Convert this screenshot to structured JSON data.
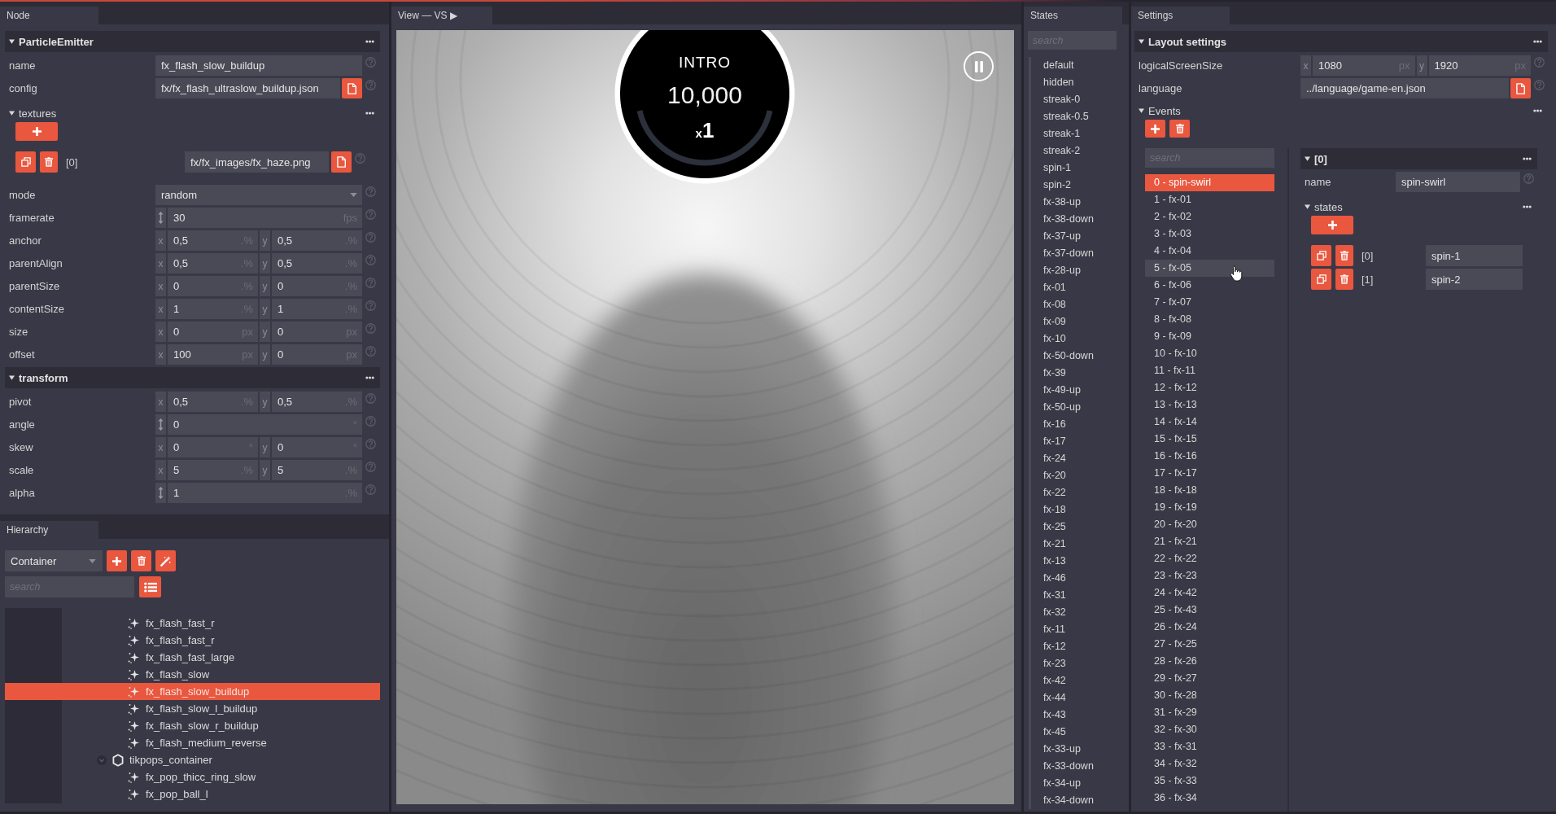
{
  "node": {
    "tab": "Node",
    "sections": [
      {
        "title": "ParticleEmitter",
        "expanded": true,
        "rows": [
          {
            "kind": "text",
            "label": "name",
            "value": "fx_flash_slow_buildup"
          },
          {
            "kind": "file",
            "label": "config",
            "value": "fx/fx_flash_ultraslow_buildup.json"
          },
          {
            "kind": "list",
            "label": "textures",
            "expanded": true,
            "items": [
              {
                "kind": "file",
                "index": "[0]",
                "value": "fx/fx_images/fx_haze.png"
              }
            ]
          },
          {
            "kind": "select",
            "label": "mode",
            "value": "random"
          },
          {
            "kind": "number",
            "label": "framerate",
            "value": "30",
            "unit": "fps"
          },
          {
            "kind": "vector",
            "label": "anchor",
            "parts": [
              {
                "axis": "x",
                "value": "0,5",
                "unit": ".%"
              },
              {
                "axis": "y",
                "value": "0,5",
                "unit": ".%"
              }
            ]
          },
          {
            "kind": "vector",
            "label": "parentAlign",
            "parts": [
              {
                "axis": "x",
                "value": "0,5",
                "unit": ".%"
              },
              {
                "axis": "y",
                "value": "0,5",
                "unit": ".%"
              }
            ]
          },
          {
            "kind": "vector",
            "label": "parentSize",
            "parts": [
              {
                "axis": "x",
                "value": "0",
                "unit": ".%"
              },
              {
                "axis": "y",
                "value": "0",
                "unit": ".%"
              }
            ]
          },
          {
            "kind": "vector",
            "label": "contentSize",
            "parts": [
              {
                "axis": "x",
                "value": "1",
                "unit": ".%"
              },
              {
                "axis": "y",
                "value": "1",
                "unit": ".%"
              }
            ]
          },
          {
            "kind": "vector",
            "label": "size",
            "parts": [
              {
                "axis": "x",
                "value": "0",
                "unit": "px"
              },
              {
                "axis": "y",
                "value": "0",
                "unit": "px"
              }
            ]
          },
          {
            "kind": "vector",
            "label": "offset",
            "parts": [
              {
                "axis": "x",
                "value": "100",
                "unit": "px"
              },
              {
                "axis": "y",
                "value": "0",
                "unit": "px"
              }
            ]
          }
        ]
      },
      {
        "title": "transform",
        "expanded": true,
        "rows": [
          {
            "kind": "vector",
            "label": "pivot",
            "parts": [
              {
                "axis": "x",
                "value": "0,5",
                "unit": ".%"
              },
              {
                "axis": "y",
                "value": "0,5",
                "unit": ".%"
              }
            ]
          },
          {
            "kind": "number",
            "label": "angle",
            "value": "0",
            "unit": "°"
          },
          {
            "kind": "vector",
            "label": "skew",
            "parts": [
              {
                "axis": "x",
                "value": "0",
                "unit": "°"
              },
              {
                "axis": "y",
                "value": "0",
                "unit": "°"
              }
            ]
          },
          {
            "kind": "vector",
            "label": "scale",
            "parts": [
              {
                "axis": "x",
                "value": "5",
                "unit": ".%"
              },
              {
                "axis": "y",
                "value": "5",
                "unit": ".%"
              }
            ]
          },
          {
            "kind": "number",
            "label": "alpha",
            "value": "1",
            "unit": ".%"
          }
        ]
      }
    ]
  },
  "hierarchy": {
    "tab": "Hierarchy",
    "type_select": "Container",
    "search_placeholder": "search",
    "tree": [
      {
        "children": [
          {
            "kind": "emitter",
            "label": "fx_flash_fast_r",
            "selected": false
          },
          {
            "kind": "emitter",
            "label": "fx_flash_fast_r",
            "selected": false
          },
          {
            "kind": "emitter",
            "label": "fx_flash_fast_large",
            "selected": false
          },
          {
            "kind": "emitter",
            "label": "fx_flash_slow",
            "selected": false
          },
          {
            "kind": "emitter",
            "label": "fx_flash_slow_buildup",
            "selected": true
          },
          {
            "kind": "emitter",
            "label": "fx_flash_slow_l_buildup",
            "selected": false
          },
          {
            "kind": "emitter",
            "label": "fx_flash_slow_r_buildup",
            "selected": false
          },
          {
            "kind": "emitter",
            "label": "fx_flash_medium_reverse",
            "selected": false
          }
        ]
      },
      {
        "kind": "container",
        "label": "tikpops_container",
        "expanded": true,
        "selected": false,
        "children": [
          {
            "kind": "emitter",
            "label": "fx_pop_thicc_ring_slow",
            "selected": false
          },
          {
            "kind": "emitter",
            "label": "fx_pop_ball_l",
            "selected": false
          }
        ]
      }
    ]
  },
  "view": {
    "tab": "View — VS ▶",
    "score": {
      "title": "INTRO",
      "points": "10,000",
      "multiplier": {
        "prefix": "x",
        "value": "1"
      }
    }
  },
  "states": {
    "tab": "States",
    "search_placeholder": "search",
    "items": [
      {
        "label": "default",
        "selected": false
      },
      {
        "label": "hidden",
        "selected": false
      },
      {
        "label": "streak-0",
        "selected": false
      },
      {
        "label": "streak-0.5",
        "selected": false
      },
      {
        "label": "streak-1",
        "selected": false
      },
      {
        "label": "streak-2",
        "selected": false
      },
      {
        "label": "spin-1",
        "selected": false
      },
      {
        "label": "spin-2",
        "selected": false
      },
      {
        "label": "fx-38-up",
        "selected": false
      },
      {
        "label": "fx-38-down",
        "selected": false
      },
      {
        "label": "fx-37-up",
        "selected": false
      },
      {
        "label": "fx-37-down",
        "selected": false
      },
      {
        "label": "fx-28-up",
        "selected": false
      },
      {
        "label": "fx-01",
        "selected": false
      },
      {
        "label": "fx-08",
        "selected": false
      },
      {
        "label": "fx-09",
        "selected": false
      },
      {
        "label": "fx-10",
        "selected": false
      },
      {
        "label": "fx-50-down",
        "selected": false
      },
      {
        "label": "fx-39",
        "selected": false
      },
      {
        "label": "fx-49-up",
        "selected": false
      },
      {
        "label": "fx-50-up",
        "selected": false
      },
      {
        "label": "fx-16",
        "selected": false
      },
      {
        "label": "fx-17",
        "selected": false
      },
      {
        "label": "fx-24",
        "selected": false
      },
      {
        "label": "fx-20",
        "selected": false
      },
      {
        "label": "fx-22",
        "selected": false
      },
      {
        "label": "fx-18",
        "selected": false
      },
      {
        "label": "fx-25",
        "selected": false
      },
      {
        "label": "fx-21",
        "selected": false
      },
      {
        "label": "fx-13",
        "selected": false
      },
      {
        "label": "fx-46",
        "selected": false
      },
      {
        "label": "fx-31",
        "selected": false
      },
      {
        "label": "fx-32",
        "selected": false
      },
      {
        "label": "fx-11",
        "selected": false
      },
      {
        "label": "fx-12",
        "selected": false
      },
      {
        "label": "fx-23",
        "selected": false
      },
      {
        "label": "fx-42",
        "selected": false
      },
      {
        "label": "fx-44",
        "selected": false
      },
      {
        "label": "fx-43",
        "selected": false
      },
      {
        "label": "fx-45",
        "selected": false
      },
      {
        "label": "fx-33-up",
        "selected": false
      },
      {
        "label": "fx-33-down",
        "selected": false
      },
      {
        "label": "fx-34-up",
        "selected": false
      },
      {
        "label": "fx-34-down",
        "selected": false
      }
    ]
  },
  "settings": {
    "tab": "Settings",
    "section": {
      "title": "Layout settings",
      "expanded": true,
      "rows": [
        {
          "kind": "vector",
          "label": "logicalScreenSize",
          "parts": [
            {
              "axis": "x",
              "value": "1080",
              "unit": "px"
            },
            {
              "axis": "y",
              "value": "1920",
              "unit": "px"
            }
          ]
        },
        {
          "kind": "file",
          "label": "language",
          "value": "../language/game-en.json"
        }
      ],
      "events": {
        "title": "Events",
        "expanded": true,
        "search_placeholder": "search",
        "items": [
          {
            "label": "0 - spin-swirl",
            "selected": true,
            "hovered": false
          },
          {
            "label": "1 - fx-01",
            "selected": false,
            "hovered": false
          },
          {
            "label": "2 - fx-02",
            "selected": false,
            "hovered": false
          },
          {
            "label": "3 - fx-03",
            "selected": false,
            "hovered": false
          },
          {
            "label": "4 - fx-04",
            "selected": false,
            "hovered": false
          },
          {
            "label": "5 - fx-05",
            "selected": false,
            "hovered": true
          },
          {
            "label": "6 - fx-06",
            "selected": false,
            "hovered": false
          },
          {
            "label": "7 - fx-07",
            "selected": false,
            "hovered": false
          },
          {
            "label": "8 - fx-08",
            "selected": false,
            "hovered": false
          },
          {
            "label": "9 - fx-09",
            "selected": false,
            "hovered": false
          },
          {
            "label": "10 - fx-10",
            "selected": false,
            "hovered": false
          },
          {
            "label": "11 - fx-11",
            "selected": false,
            "hovered": false
          },
          {
            "label": "12 - fx-12",
            "selected": false,
            "hovered": false
          },
          {
            "label": "13 - fx-13",
            "selected": false,
            "hovered": false
          },
          {
            "label": "14 - fx-14",
            "selected": false,
            "hovered": false
          },
          {
            "label": "15 - fx-15",
            "selected": false,
            "hovered": false
          },
          {
            "label": "16 - fx-16",
            "selected": false,
            "hovered": false
          },
          {
            "label": "17 - fx-17",
            "selected": false,
            "hovered": false
          },
          {
            "label": "18 - fx-18",
            "selected": false,
            "hovered": false
          },
          {
            "label": "19 - fx-19",
            "selected": false,
            "hovered": false
          },
          {
            "label": "20 - fx-20",
            "selected": false,
            "hovered": false
          },
          {
            "label": "21 - fx-21",
            "selected": false,
            "hovered": false
          },
          {
            "label": "22 - fx-22",
            "selected": false,
            "hovered": false
          },
          {
            "label": "23 - fx-23",
            "selected": false,
            "hovered": false
          },
          {
            "label": "24 - fx-42",
            "selected": false,
            "hovered": false
          },
          {
            "label": "25 - fx-43",
            "selected": false,
            "hovered": false
          },
          {
            "label": "26 - fx-24",
            "selected": false,
            "hovered": false
          },
          {
            "label": "27 - fx-25",
            "selected": false,
            "hovered": false
          },
          {
            "label": "28 - fx-26",
            "selected": false,
            "hovered": false
          },
          {
            "label": "29 - fx-27",
            "selected": false,
            "hovered": false
          },
          {
            "label": "30 - fx-28",
            "selected": false,
            "hovered": false
          },
          {
            "label": "31 - fx-29",
            "selected": false,
            "hovered": false
          },
          {
            "label": "32 - fx-30",
            "selected": false,
            "hovered": false
          },
          {
            "label": "33 - fx-31",
            "selected": false,
            "hovered": false
          },
          {
            "label": "34 - fx-32",
            "selected": false,
            "hovered": false
          },
          {
            "label": "35 - fx-33",
            "selected": false,
            "hovered": false
          },
          {
            "label": "36 - fx-34",
            "selected": false,
            "hovered": false
          }
        ],
        "detail": {
          "title": "[0]",
          "expanded": true,
          "rows": [
            {
              "kind": "text",
              "label": "name",
              "value": "spin-swirl"
            },
            {
              "kind": "list",
              "label": "states",
              "expanded": true,
              "items": [
                {
                  "kind": "text",
                  "index": "[0]",
                  "value": "spin-1"
                },
                {
                  "kind": "text",
                  "index": "[1]",
                  "value": "spin-2"
                }
              ]
            }
          ]
        }
      }
    }
  }
}
